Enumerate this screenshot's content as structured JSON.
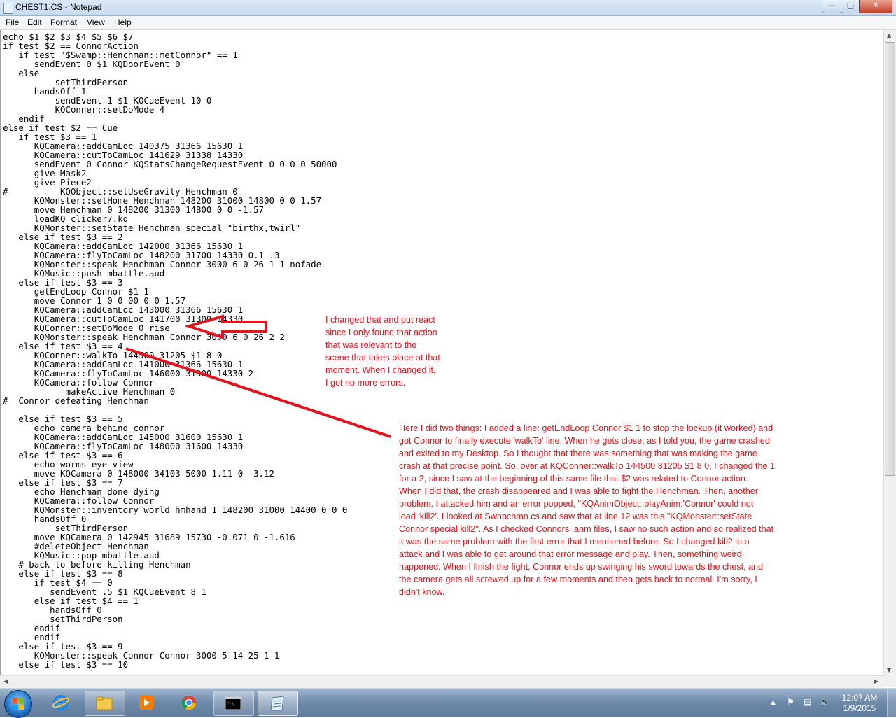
{
  "window": {
    "title": "CHEST1.CS - Notepad",
    "minimize_glyph": "—",
    "maximize_glyph": "▢",
    "close_glyph": "✕"
  },
  "menu": [
    "File",
    "Edit",
    "Format",
    "View",
    "Help"
  ],
  "document": {
    "lines": [
      "echo $1 $2 $3 $4 $5 $6 $7",
      "if test $2 == ConnorAction",
      "   if test \"$Swamp::Henchman::metConnor\" == 1",
      "      sendEvent 0 $1 KQDoorEvent 0",
      "   else",
      "          setThirdPerson",
      "      handsOff 1",
      "          sendEvent 1 $1 KQCueEvent 10 0",
      "          KQConner::setDoMode 4",
      "   endif",
      "else if test $2 == Cue",
      "   if test $3 == 1",
      "      KQCamera::addCamLoc 140375 31366 15630 1",
      "      KQCamera::cutToCamLoc 141629 31338 14330",
      "      sendEvent 0 Connor KQStatsChangeRequestEvent 0 0 0 0 50000",
      "      give Mask2",
      "      give Piece2",
      "#          KQObject::setUseGravity Henchman 0",
      "      KQMonster::setHome Henchman 148200 31000 14800 0 0 1.57",
      "      move Henchman 0 148200 31300 14800 0 0 -1.57",
      "      loadKQ clicker7.kq",
      "      KQMonster::setState Henchman special \"birthx,twirl\"",
      "   else if test $3 == 2",
      "      KQCamera::addCamLoc 142000 31366 15630 1",
      "      KQCamera::flyToCamLoc 148200 31700 14330 0.1 .3",
      "      KQMonster::speak Henchman Connor 3000 6 0 26 1 1 nofade",
      "      KQMusic::push mbattle.aud",
      "   else if test $3 == 3",
      "      getEndLoop Connor $1 1",
      "      move Connor 1 0 0 00 0 0 1.57",
      "      KQCamera::addCamLoc 143000 31366 15630 1",
      "      KQCamera::cutToCamLoc 141700 31300 14330",
      "      KQConner::setDoMode 0 rise",
      "      KQMonster::speak Henchman Connor 3000 6 0 26 2 2",
      "   else if test $3 == 4",
      "      KQConner::walkTo 144500 31205 $1 8 0",
      "      KQCamera::addCamLoc 141000 31366 15630 1",
      "      KQCamera::flyToCamLoc 146000 31300 14330 2",
      "      KQCamera::follow Connor",
      "            makeActive Henchman 0",
      "#  Connor defeating Henchman",
      "",
      "   else if test $3 == 5",
      "      echo camera behind connor",
      "      KQCamera::addCamLoc 145000 31600 15630 1",
      "      KQCamera::flyToCamLoc 148000 31600 14330",
      "   else if test $3 == 6",
      "      echo worms eye view",
      "      move KQCamera 0 148000 34103 5000 1.11 0 -3.12",
      "   else if test $3 == 7",
      "      echo Henchman done dying",
      "      KQCamera::follow Connor",
      "      KQMonster::inventory world hmhand 1 148200 31000 14400 0 0 0",
      "      handsOff 0",
      "          setThirdPerson",
      "      move KQCamera 0 142945 31689 15730 -0.071 0 -1.616",
      "      #deleteObject Henchman",
      "      KQMusic::pop mbattle.aud",
      "   # back to before killing Henchman",
      "   else if test $3 == 8",
      "      if test $4 == 0",
      "         sendEvent .5 $1 KQCueEvent 8 1",
      "      else if test $4 == 1",
      "         handsOff 0",
      "         setThirdPerson",
      "      endif",
      "      endif",
      "   else if test $3 == 9",
      "      KQMonster::speak Connor Connor 3000 5 14 25 1 1",
      "   else if test $3 == 10"
    ]
  },
  "annotations": {
    "note_short": [
      "I changed that and put react",
      "since I only found that action",
      "that was relevant to the",
      "scene that takes place at that",
      "moment. When I changed it,",
      "I got no more errors."
    ],
    "note_long": [
      "Here I did two things: I added a line: getEndLoop Connor $1 1 to stop the lockup (it worked) and",
      "got Connor to finally execute 'walkTo' line. When he gets close, as I told you, the game crashed",
      "and exited to my Desktop. So I thought that there was something that was making the game",
      "crash at that precise point. So, over at KQConner::walkTo 144500 31205 $1 8 0, I changed the 1",
      "for a 2, since I saw at the beginning of this same file that $2 was related to Connor action.",
      "When I did that, the crash disappeared and I was able to fight the Henchman. Then, another",
      "problem. I attacked him and an error popped, \"KQAnimObject::playAnim:'Connor' could not",
      "load 'kill2'. I looked at Swhnchmn.cs and saw that at line 12 was this \"KQMonster::setState",
      "Connor special kill2\". As I checked Connors .anm files, I saw no such action and so realized that",
      "it was the same problem with the first error that I mentioned before. So I changed kill2 into",
      "attack and I was able to get around that error message and play. Then, something weird",
      "happened. When I finish the fight, Connor ends up swinging his sword towards the chest, and",
      "the camera gets all screwed up for a few moments and then gets back to normal. I'm sorry, I",
      "didn't know."
    ],
    "color": "#e0141e"
  },
  "taskbar": {
    "apps": [
      "start-button",
      "internet-explorer",
      "file-explorer",
      "media-player",
      "chrome",
      "command-prompt",
      "notepad"
    ],
    "tray": {
      "up_arrow": "▲",
      "flag": "⚑",
      "network": "▤",
      "volume": "🔈"
    },
    "clock_time": "12:07 AM",
    "clock_date": "1/9/2015"
  }
}
